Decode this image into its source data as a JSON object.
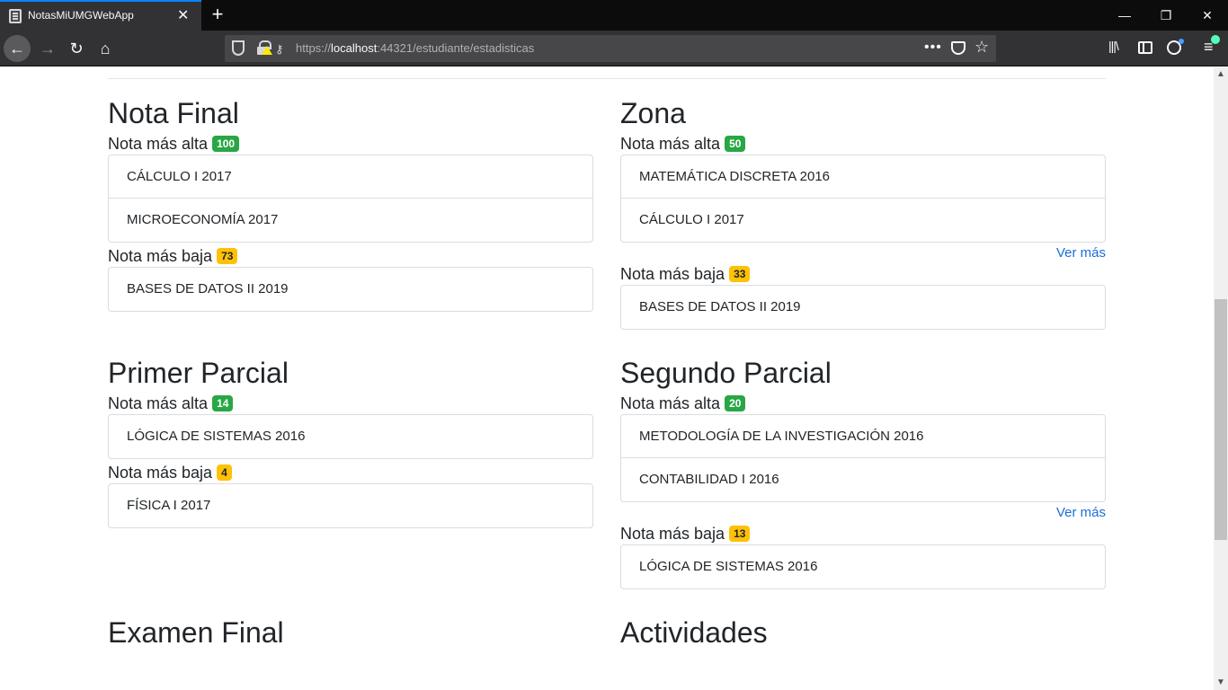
{
  "browser": {
    "tab_title": "NotasMiUMGWebApp",
    "url_prefix": "https://",
    "url_host": "localhost",
    "url_rest": ":44321/estudiante/estadisticas",
    "icons": {
      "back": "arrow-left-icon",
      "forward": "arrow-right-icon",
      "reload": "reload-icon",
      "home": "home-icon",
      "close": "close-icon",
      "new_tab": "plus-icon"
    },
    "glyphs": {
      "tab_close": "✕",
      "new_tab": "+",
      "minimize": "—",
      "maximize": "❐",
      "close": "✕",
      "back": "←",
      "forward": "→",
      "reload": "↻",
      "home": "⌂",
      "dots": "•••",
      "star": "☆",
      "library": "|||\\",
      "menu": "≡",
      "key": "⚷",
      "scroll_up": "▲",
      "scroll_down": "▼"
    }
  },
  "colors": {
    "badge_high": "#28a745",
    "badge_low": "#ffc107",
    "link": "#1a6ed8"
  },
  "labels": {
    "high": "Nota más alta",
    "low": "Nota más baja",
    "more": "Ver más"
  },
  "sections": {
    "nota_final": {
      "title": "Nota Final",
      "high_value": "100",
      "high_items": [
        "CÁLCULO I 2017",
        "MICROECONOMÍA 2017"
      ],
      "low_value": "73",
      "low_items": [
        "BASES DE DATOS II 2019"
      ]
    },
    "zona": {
      "title": "Zona",
      "high_value": "50",
      "high_items": [
        "MATEMÁTICA DISCRETA 2016",
        "CÁLCULO I 2017"
      ],
      "low_value": "33",
      "low_items": [
        "BASES DE DATOS II 2019"
      ]
    },
    "primer_parcial": {
      "title": "Primer Parcial",
      "high_value": "14",
      "high_items": [
        "LÓGICA DE SISTEMAS 2016"
      ],
      "low_value": "4",
      "low_items": [
        "FÍSICA I 2017"
      ]
    },
    "segundo_parcial": {
      "title": "Segundo Parcial",
      "high_value": "20",
      "high_items": [
        "METODOLOGÍA DE LA INVESTIGACIÓN 2016",
        "CONTABILIDAD I 2016"
      ],
      "low_value": "13",
      "low_items": [
        "LÓGICA DE SISTEMAS 2016"
      ]
    },
    "examen_final": {
      "title": "Examen Final"
    },
    "actividades": {
      "title": "Actividades"
    }
  }
}
